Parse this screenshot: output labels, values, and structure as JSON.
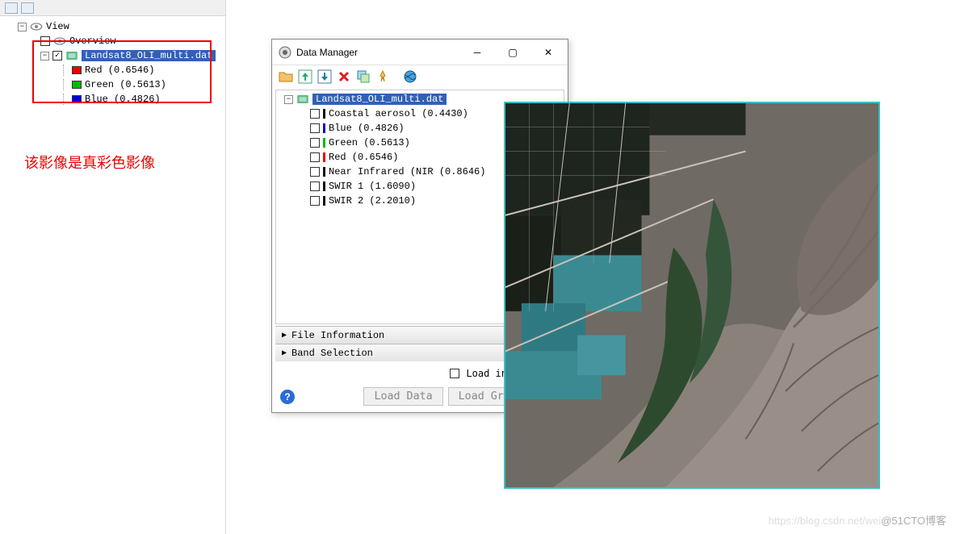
{
  "left_tree": {
    "root": "View",
    "overview": "Overview",
    "file": "Landsat8_OLI_multi.dat",
    "bands": [
      {
        "label": "Red (0.6546)",
        "color": "red"
      },
      {
        "label": "Green (0.5613)",
        "color": "green"
      },
      {
        "label": "Blue (0.4826)",
        "color": "blue"
      }
    ]
  },
  "annotation": "该影像是真彩色影像",
  "data_manager": {
    "title": "Data Manager",
    "file": "Landsat8_OLI_multi.dat",
    "bands": [
      {
        "label": "Coastal aerosol (0.4430)",
        "mark": "n"
      },
      {
        "label": "Blue (0.4826)",
        "mark": "b"
      },
      {
        "label": "Green (0.5613)",
        "mark": "g"
      },
      {
        "label": "Red (0.6546)",
        "mark": "r"
      },
      {
        "label": "Near Infrared (NIR (0.8646)",
        "mark": "n"
      },
      {
        "label": "SWIR 1 (1.6090)",
        "mark": "n"
      },
      {
        "label": "SWIR 2 (2.2010)",
        "mark": "n"
      }
    ],
    "sections": {
      "file_info": "File Information",
      "band_sel": "Band Selection"
    },
    "load_in_new_view": "Load in New View",
    "buttons": {
      "load_data": "Load Data",
      "load_grayscale": "Load Grayscale"
    }
  },
  "watermark": {
    "faint": "https://blog.csdn.net/wei",
    "text": "@51CTO博客"
  }
}
